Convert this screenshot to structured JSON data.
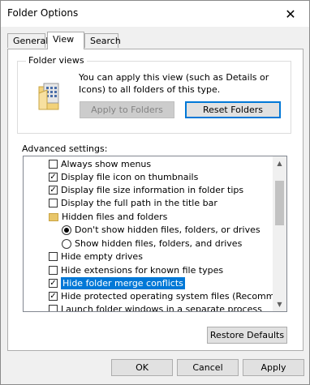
{
  "window": {
    "title": "Folder Options",
    "close_glyph": "✕"
  },
  "tabs": [
    {
      "label": "General",
      "active": false
    },
    {
      "label": "View",
      "active": true
    },
    {
      "label": "Search",
      "active": false
    }
  ],
  "folder_views": {
    "label": "Folder views",
    "description": "You can apply this view (such as Details or Icons) to all folders of this type.",
    "apply_button": "Apply to Folders",
    "reset_button": "Reset Folders"
  },
  "advanced": {
    "label": "Advanced settings:",
    "items": [
      {
        "kind": "checkbox",
        "label": "Always show menus",
        "checked": false
      },
      {
        "kind": "checkbox",
        "label": "Display file icon on thumbnails",
        "checked": true
      },
      {
        "kind": "checkbox",
        "label": "Display file size information in folder tips",
        "checked": true
      },
      {
        "kind": "checkbox",
        "label": "Display the full path in the title bar",
        "checked": false
      },
      {
        "kind": "folder",
        "label": "Hidden files and folders"
      },
      {
        "kind": "radio",
        "label": "Don't show hidden files, folders, or drives",
        "checked": true
      },
      {
        "kind": "radio",
        "label": "Show hidden files, folders, and drives",
        "checked": false
      },
      {
        "kind": "checkbox",
        "label": "Hide empty drives",
        "checked": false
      },
      {
        "kind": "checkbox",
        "label": "Hide extensions for known file types",
        "checked": false
      },
      {
        "kind": "checkbox",
        "label": "Hide folder merge conflicts",
        "checked": true,
        "selected": true
      },
      {
        "kind": "checkbox",
        "label": "Hide protected operating system files (Recommended)",
        "checked": true
      },
      {
        "kind": "checkbox",
        "label": "Launch folder windows in a separate process",
        "checked": false
      }
    ],
    "restore_button": "Restore Defaults"
  },
  "footer": {
    "ok": "OK",
    "cancel": "Cancel",
    "apply": "Apply"
  },
  "colors": {
    "selection": "#0078d7",
    "folder": "#e8c66a"
  }
}
